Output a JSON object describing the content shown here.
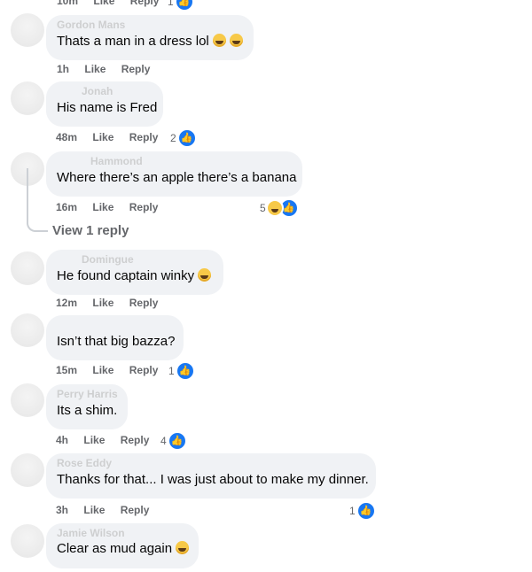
{
  "comments": [
    {
      "author": "Gordon Mans",
      "text": "Thats a man in a dress lol",
      "time": "1h",
      "like": "Like",
      "reply": "Reply",
      "reaction_count": "",
      "emoji": "laughing-icon"
    },
    {
      "author": "Jonah",
      "text": "His name is Fred",
      "time": "48m",
      "like": "Like",
      "reply": "Reply",
      "reaction_count": "2"
    },
    {
      "author": "Hammond",
      "text": "Where there’s an apple there’s a banana",
      "time": "16m",
      "like": "Like",
      "reply": "Reply",
      "reaction_count": "5"
    },
    {
      "author": "Domingue",
      "text": "He found captain winky",
      "time": "12m",
      "like": "Like",
      "reply": "Reply",
      "reaction_count": ""
    },
    {
      "author": "",
      "text": "Isn’t that big bazza?",
      "time": "15m",
      "like": "Like",
      "reply": "Reply",
      "reaction_count": "1"
    },
    {
      "author": "Perry Harris",
      "text": "Its a shim.",
      "time": "4h",
      "like": "Like",
      "reply": "Reply",
      "reaction_count": "4"
    },
    {
      "author": "Rose Eddy",
      "text": "Thanks for that... I was just about to make my dinner.",
      "time": "3h",
      "like": "Like",
      "reply": "Reply",
      "reaction_count": "1"
    },
    {
      "author": "Jamie Wilson",
      "text": "Clear as mud again",
      "time": "",
      "like": "",
      "reply": "",
      "reaction_count": ""
    }
  ],
  "top_row": {
    "time": "10m",
    "like": "Like",
    "reply": "Reply",
    "reaction_count": "1"
  },
  "view_replies": "View 1 reply",
  "colors": {
    "bubble": "#f0f2f5",
    "like_blue": "#1877f2",
    "meta_gray": "#65676b"
  }
}
